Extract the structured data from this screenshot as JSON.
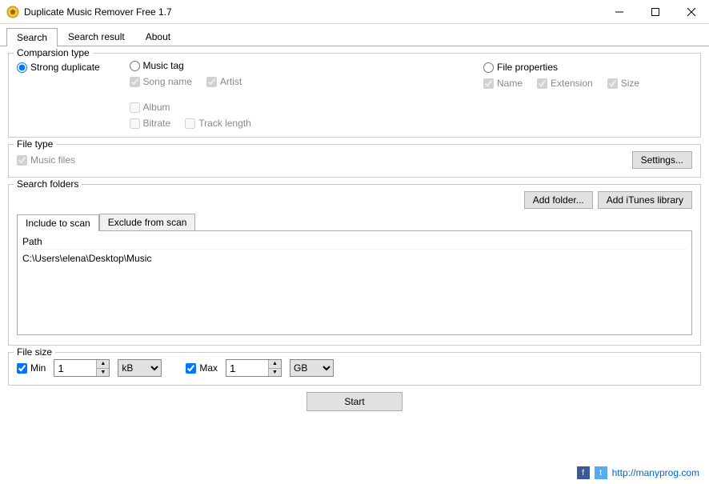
{
  "titlebar": {
    "title": "Duplicate Music Remover Free 1.7"
  },
  "tabs": {
    "search": "Search",
    "search_result": "Search result",
    "about": "About"
  },
  "comparison": {
    "legend": "Comparsion type",
    "strong": "Strong duplicate",
    "music_tag": "Music tag",
    "file_props": "File properties",
    "song_name": "Song name",
    "artist": "Artist",
    "album": "Album",
    "bitrate": "Bitrate",
    "track_length": "Track length",
    "name": "Name",
    "extension": "Extension",
    "size": "Size"
  },
  "filetype": {
    "legend": "File type",
    "music_files": "Music files",
    "settings_btn": "Settings..."
  },
  "folders": {
    "legend": "Search folders",
    "add_folder": "Add folder...",
    "add_itunes": "Add iTunes library",
    "include_tab": "Include to scan",
    "exclude_tab": "Exclude from scan",
    "path_header": "Path",
    "paths": [
      "C:\\Users\\elena\\Desktop\\Music"
    ]
  },
  "filesize": {
    "legend": "File size",
    "min_label": "Min",
    "min_value": "1",
    "min_unit": "kB",
    "max_label": "Max",
    "max_value": "1",
    "max_unit": "GB"
  },
  "start_btn": "Start",
  "footer": {
    "url": "http://manyprog.com"
  }
}
